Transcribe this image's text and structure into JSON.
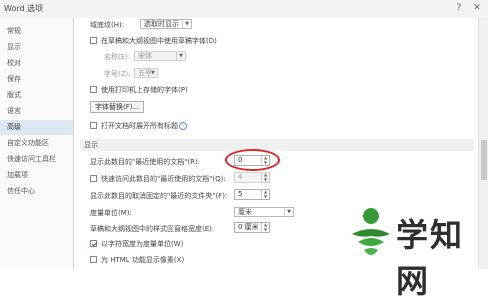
{
  "window": {
    "title": "Word 选项"
  },
  "sidebar": {
    "items": [
      {
        "label": "常规"
      },
      {
        "label": "显示"
      },
      {
        "label": "校对"
      },
      {
        "label": "保存"
      },
      {
        "label": "版式"
      },
      {
        "label": "语言"
      },
      {
        "label": "高级",
        "active": true
      },
      {
        "label": "自定义功能区"
      },
      {
        "label": "快速访问工具栏"
      },
      {
        "label": "加载项"
      },
      {
        "label": "信任中心"
      }
    ]
  },
  "font_section": {
    "field_shading_label": "域底纹(H):",
    "field_shading_value": "选取时显示",
    "draft_font_label": "在草稿和大纲视图中使用草稿字体(D)",
    "name_label": "名称(E):",
    "name_value": "宋体",
    "size_label": "字号(Z):",
    "size_value": "五号",
    "printer_fonts_label": "使用打印机上存储的字体(P)",
    "font_sub_button": "字体替换(F)...",
    "expand_headings_label": "打开文档时展开所有标题",
    "info_icon": "i"
  },
  "display_section": {
    "header": "显示",
    "recent_docs_label": "显示此数目的\"最近使用的文档\"(R):",
    "recent_docs_value": "0",
    "quick_access_label": "快速访问此数目的\"最近使用的文档\"(Q):",
    "quick_access_value": "4",
    "unpinned_folders_label": "显示此数目的取消固定的\"最近的文件夹\"(F):",
    "unpinned_folders_value": "5",
    "units_label": "度量单位(M):",
    "units_value": "厘米",
    "style_width_label": "草稿和大纲视图中的样式区窗格宽度(E):",
    "style_width_value": "0 厘米",
    "char_width_label": "以字符宽度为度量单位(W)",
    "html_pixels_label": "为 HTML 功能显示像素(X)"
  },
  "watermark": {
    "text": "学知网"
  }
}
